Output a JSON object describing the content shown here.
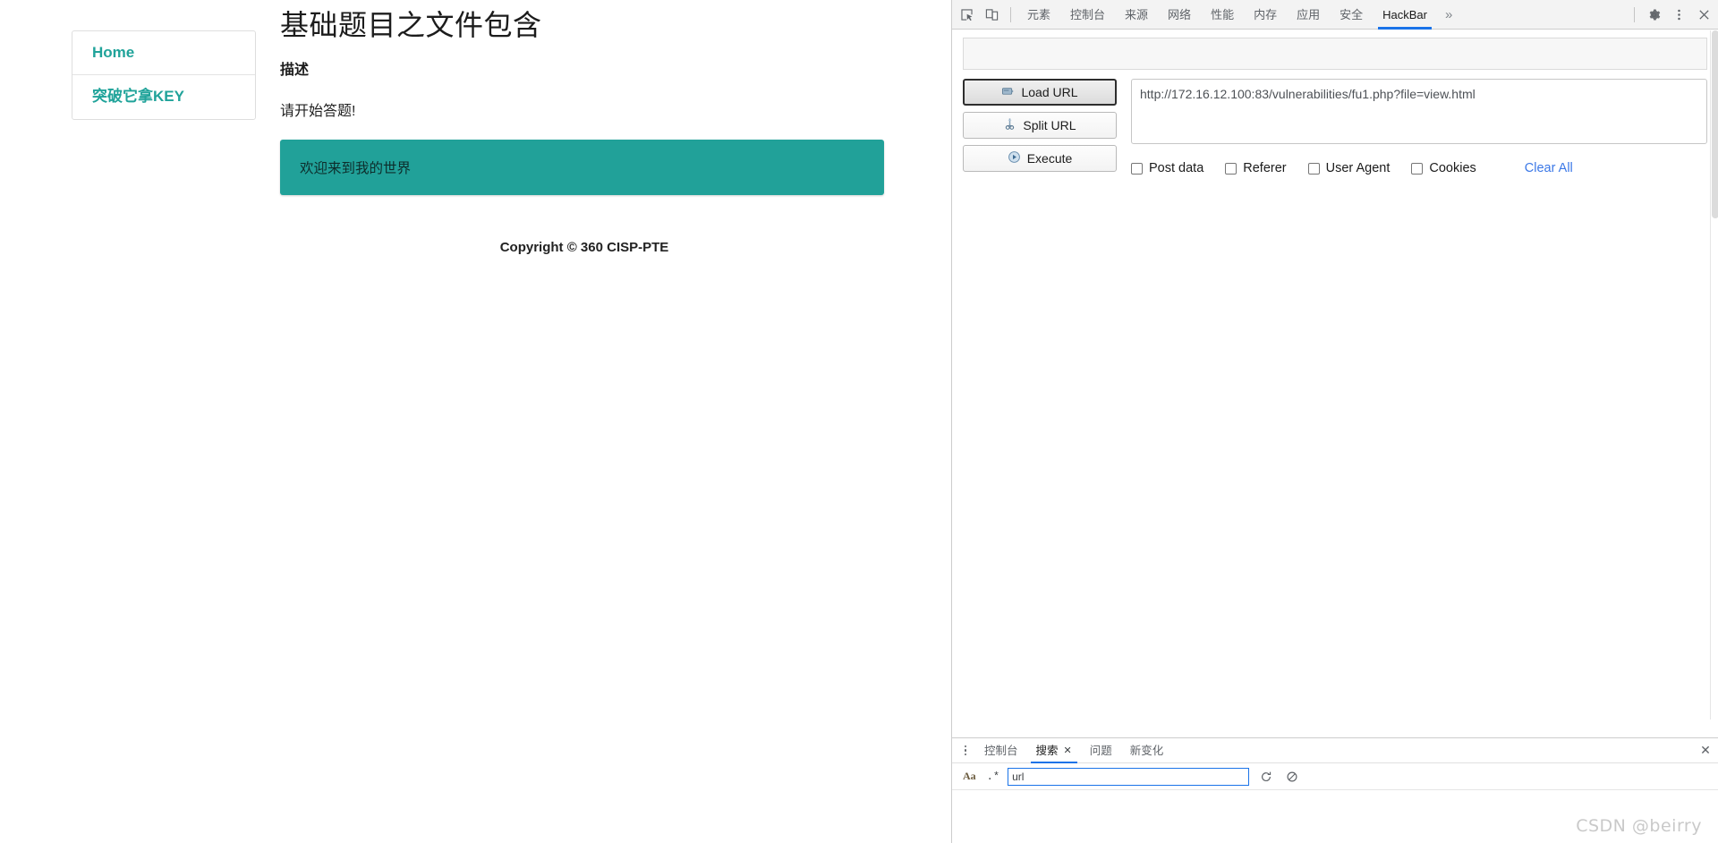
{
  "webpage": {
    "sidebar": {
      "items": [
        {
          "label": "Home",
          "name": "sidebar-item-home"
        },
        {
          "label": "突破它拿KEY",
          "name": "sidebar-item-get-key"
        }
      ]
    },
    "title": "基础题目之文件包含",
    "description_heading": "描述",
    "description_text": "请开始答题!",
    "result_box_text": "欢迎来到我的世界",
    "result_box_color": "#21a199",
    "copyright": "Copyright © 360 CISP-PTE"
  },
  "devtools": {
    "toolbar": {
      "inspect_icon": "inspect-cursor-icon",
      "device_icon": "device-toolbar-icon",
      "tabs": [
        {
          "label": "元素",
          "active": false
        },
        {
          "label": "控制台",
          "active": false
        },
        {
          "label": "来源",
          "active": false
        },
        {
          "label": "网络",
          "active": false
        },
        {
          "label": "性能",
          "active": false
        },
        {
          "label": "内存",
          "active": false
        },
        {
          "label": "应用",
          "active": false
        },
        {
          "label": "安全",
          "active": false
        },
        {
          "label": "HackBar",
          "active": true
        }
      ],
      "more_tabs_label": "»",
      "settings_icon": "gear-icon",
      "menu_icon": "kebab-menu-icon",
      "close_icon": "close-icon",
      "accent_color": "#1a73e8"
    },
    "hackbar": {
      "buttons": [
        {
          "label": "Load URL",
          "icon": "load-url-icon",
          "primary": true
        },
        {
          "label": "Split URL",
          "icon": "scissors-icon",
          "primary": false
        },
        {
          "label": "Execute",
          "icon": "play-icon",
          "primary": false
        }
      ],
      "url_value": "http://172.16.12.100:83/vulnerabilities/fu1.php?file=view.html",
      "url_placeholder": "",
      "checkboxes": [
        {
          "label": "Post data",
          "checked": false
        },
        {
          "label": "Referer",
          "checked": false
        },
        {
          "label": "User Agent",
          "checked": false
        },
        {
          "label": "Cookies",
          "checked": false
        }
      ],
      "clear_all_label": "Clear All",
      "clear_all_color": "#3b78e7"
    },
    "drawer": {
      "menu_icon": "kebab-menu-icon",
      "tabs": [
        {
          "label": "控制台",
          "active": false,
          "closable": false
        },
        {
          "label": "搜索",
          "active": true,
          "closable": true
        },
        {
          "label": "问题",
          "active": false,
          "closable": false
        },
        {
          "label": "新变化",
          "active": false,
          "closable": false
        }
      ],
      "close_label": "✕",
      "search": {
        "match_case_label": "Aa",
        "regex_label": ".*",
        "value": "url",
        "placeholder": "",
        "refresh_icon": "refresh-icon",
        "cancel_icon": "cancel-icon"
      }
    }
  },
  "watermark": "CSDN @beirry"
}
